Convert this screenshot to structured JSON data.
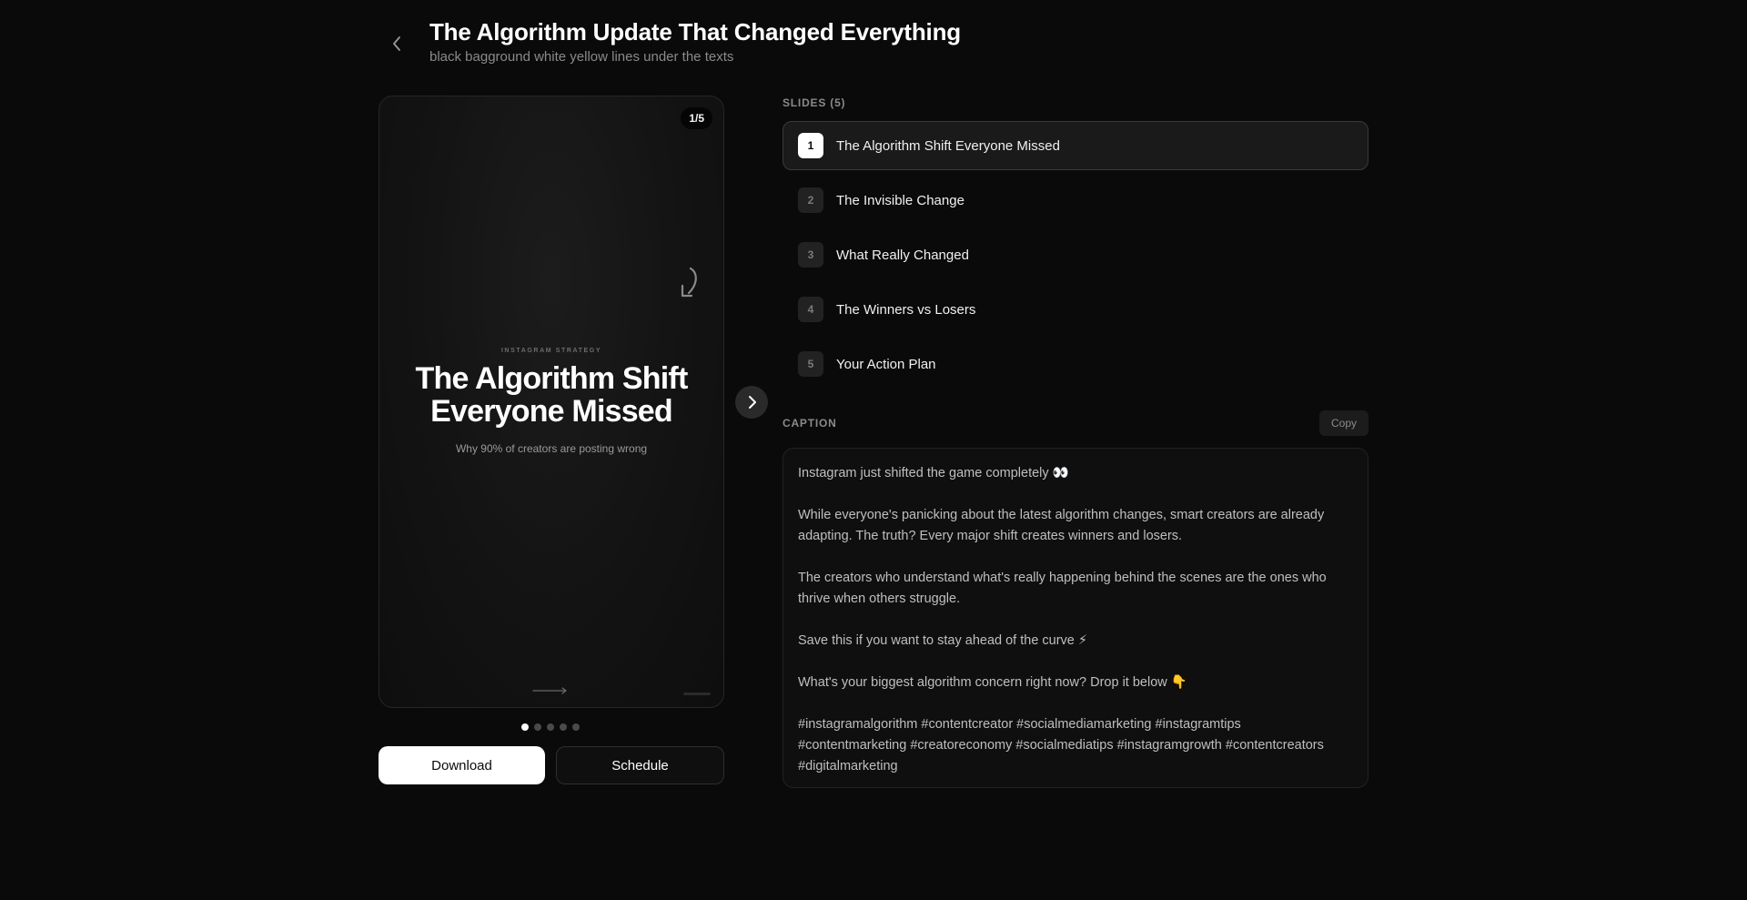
{
  "header": {
    "title": "The Algorithm Update That Changed Everything",
    "subtitle": "black bagground white yellow lines under the texts"
  },
  "preview": {
    "counter": "1/5",
    "kicker": "INSTAGRAM STRATEGY",
    "headline": "The Algorithm Shift Everyone Missed",
    "subheadline": "Why 90% of creators are posting wrong",
    "total_slides": 5,
    "active_slide": 1
  },
  "actions": {
    "download": "Download",
    "schedule": "Schedule"
  },
  "slides": {
    "label": "SLIDES (5)",
    "items": [
      {
        "num": "1",
        "title": "The Algorithm Shift Everyone Missed",
        "active": true
      },
      {
        "num": "2",
        "title": "The Invisible Change",
        "active": false
      },
      {
        "num": "3",
        "title": "What Really Changed",
        "active": false
      },
      {
        "num": "4",
        "title": "The Winners vs Losers",
        "active": false
      },
      {
        "num": "5",
        "title": "Your Action Plan",
        "active": false
      }
    ]
  },
  "caption": {
    "label": "CAPTION",
    "copy_label": "Copy",
    "paragraphs": [
      "Instagram just shifted the game completely 👀",
      "While everyone's panicking about the latest algorithm changes, smart creators are already adapting. The truth? Every major shift creates winners and losers.",
      "The creators who understand what's really happening behind the scenes are the ones who thrive when others struggle.",
      "Save this if you want to stay ahead of the curve ⚡",
      "What's your biggest algorithm concern right now? Drop it below 👇",
      "#instagramalgorithm #contentcreator #socialmediamarketing #instagramtips #contentmarketing #creatoreconomy #socialmediatips #instagramgrowth #contentcreators #digitalmarketing"
    ]
  },
  "icons": {
    "back": "chevron-left-icon",
    "next": "chevron-right-icon",
    "curl": "curved-arrow-icon",
    "slide_arrow": "long-arrow-right-icon"
  }
}
